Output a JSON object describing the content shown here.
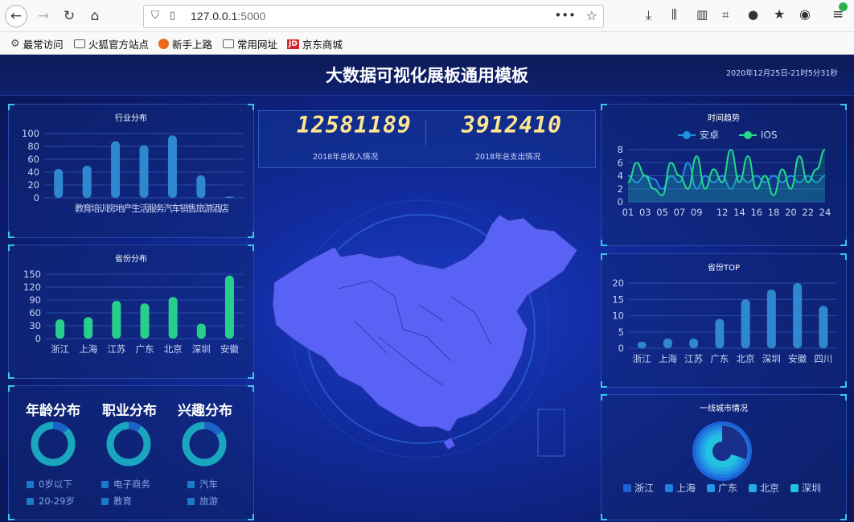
{
  "browser": {
    "url_host": "127.0.0.1",
    "url_port": ":5000",
    "bookmarks": [
      "最常访问",
      "火狐官方站点",
      "新手上路",
      "常用网址",
      "京东商城"
    ],
    "jd_badge": "JD"
  },
  "header": {
    "title": "大数据可视化展板通用模板",
    "datetime": "2020年12月25日-21时5分31秒"
  },
  "stats": {
    "income_value": "12581189",
    "income_label": "2018年总收入情况",
    "expense_value": "3912410",
    "expense_label": "2018年总支出情况"
  },
  "industry": {
    "title": "行业分布",
    "chart_data": {
      "type": "bar",
      "categories": [
        "教育培训",
        "房地产",
        "生活服务",
        "汽车销售",
        "旅游酒店",
        "",
        ""
      ],
      "values": [
        45,
        50,
        88,
        82,
        97,
        35,
        2
      ],
      "ylim": [
        0,
        100
      ],
      "yticks": [
        "0",
        "20",
        "40",
        "60",
        "80",
        "100"
      ],
      "xlabel_text": "教育培训房地产生活服务汽车销售旅游酒店",
      "color": "#2f87cf"
    }
  },
  "province": {
    "title": "省份分布",
    "chart_data": {
      "type": "bar",
      "categories": [
        "浙江",
        "上海",
        "江苏",
        "广东",
        "北京",
        "深圳",
        "安徽"
      ],
      "values": [
        45,
        50,
        88,
        82,
        97,
        35,
        147
      ],
      "ylim": [
        0,
        150
      ],
      "yticks": [
        "0",
        "30",
        "60",
        "90",
        "120",
        "150"
      ],
      "color": "#27d08a"
    }
  },
  "trend": {
    "title": "时间趋势",
    "chart_data": {
      "type": "line",
      "x": [
        "01",
        "02",
        "03",
        "04",
        "05",
        "06",
        "07",
        "08",
        "09",
        "10",
        "11",
        "12",
        "13",
        "14",
        "15",
        "16",
        "17",
        "18",
        "19",
        "20",
        "21",
        "22",
        "23",
        "24"
      ],
      "xticks": [
        "01",
        "03",
        "05",
        "07",
        "09",
        "12",
        "14",
        "16",
        "18",
        "20",
        "22",
        "24"
      ],
      "ylim": [
        0,
        8
      ],
      "yticks": [
        "0",
        "2",
        "4",
        "6",
        "8"
      ],
      "series": [
        {
          "name": "安卓",
          "color": "#1f8fe0",
          "values": [
            4,
            3,
            4,
            3.5,
            2,
            4,
            3,
            6,
            2,
            4,
            3,
            4,
            2,
            4,
            3,
            4,
            3,
            4,
            3,
            4,
            3,
            4,
            3,
            4
          ]
        },
        {
          "name": "IOS",
          "color": "#23d98a",
          "values": [
            3,
            6,
            4,
            2,
            1,
            6,
            4,
            2,
            7,
            2,
            5,
            3,
            8,
            3,
            7,
            2,
            4,
            1,
            5,
            2,
            7,
            3,
            5,
            8
          ]
        }
      ]
    }
  },
  "province_top": {
    "title": "省份TOP",
    "chart_data": {
      "type": "bar",
      "categories": [
        "浙江",
        "上海",
        "江苏",
        "广东",
        "北京",
        "深圳",
        "安徽",
        "四川"
      ],
      "values": [
        2,
        3,
        3,
        9,
        15,
        18,
        20,
        13
      ],
      "ylim": [
        0,
        20
      ],
      "yticks": [
        "0",
        "5",
        "10",
        "15",
        "20"
      ],
      "color": "#2f87cf"
    }
  },
  "city": {
    "title": "一线城市情况",
    "legend": [
      "浙江",
      "上海",
      "广东",
      "北京",
      "深圳"
    ],
    "colors": [
      "#1b63d6",
      "#1f7ee0",
      "#2396e6",
      "#20ade6",
      "#22c2e0"
    ]
  },
  "donuts": [
    {
      "title": "年龄分布",
      "legend": [
        "0岁以下",
        "20-29岁"
      ]
    },
    {
      "title": "职业分布",
      "legend": [
        "电子商务",
        "教育"
      ]
    },
    {
      "title": "兴趣分布",
      "legend": [
        "汽车",
        "旅游"
      ]
    }
  ]
}
